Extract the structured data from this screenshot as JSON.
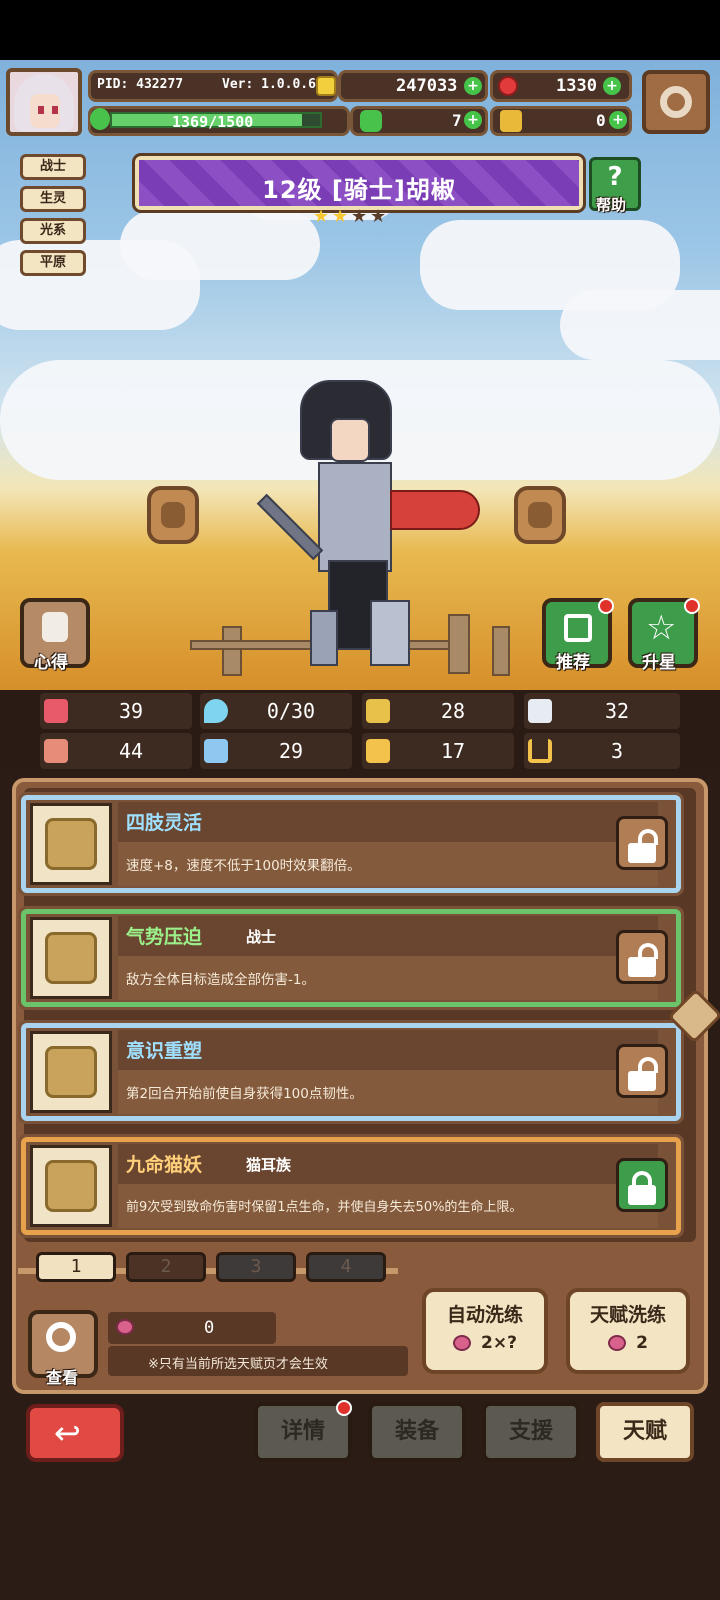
{
  "header": {
    "pid": "PID: 432277",
    "version": "Ver: 1.0.0.6",
    "gold": "247033",
    "gems": "1330",
    "xp": "1369/1500",
    "clover": "7",
    "keys": "0"
  },
  "tags": [
    "战士",
    "生灵",
    "光系",
    "平原"
  ],
  "title": "12级  [骑士]胡椒",
  "stars_filled": 2,
  "stars_total": 4,
  "help_label": "帮助",
  "side_buttons": {
    "notes": "心得",
    "recommend": "推荐",
    "upgrade_star": "升星"
  },
  "stats": [
    {
      "icon": "heart-icon",
      "value": "39",
      "color": "#e85a6a"
    },
    {
      "icon": "mana-drop-icon",
      "value": "0/30",
      "color": "#7fd4f0"
    },
    {
      "icon": "shield-icon",
      "value": "28",
      "color": "#e8c14a"
    },
    {
      "icon": "wing-icon",
      "value": "32",
      "color": "#e7ecf2"
    },
    {
      "icon": "fist-icon",
      "value": "44",
      "color": "#e88c7a"
    },
    {
      "icon": "book-icon",
      "value": "29",
      "color": "#8ec7ef"
    },
    {
      "icon": "boot-icon",
      "value": "17",
      "color": "#f2c24a"
    },
    {
      "icon": "horseshoe-icon",
      "value": "3",
      "color": "#f2c24a"
    }
  ],
  "talents": [
    {
      "name": "四肢灵活",
      "subtitle": "",
      "desc": "速度+8，速度不低于100时效果翻倍。",
      "frame": "#a8d4f0",
      "name_color": "#9fe0ff",
      "locked": false
    },
    {
      "name": "气势压迫",
      "subtitle": "战士",
      "desc": "敌方全体目标造成全部伤害-1。",
      "frame": "#6cc46a",
      "name_color": "#9cf08a",
      "locked": false
    },
    {
      "name": "意识重塑",
      "subtitle": "",
      "desc": "第2回合开始前使自身获得100点韧性。",
      "frame": "#a8d4f0",
      "name_color": "#9fe0ff",
      "locked": false
    },
    {
      "name": "九命猫妖",
      "subtitle": "猫耳族",
      "desc": "前9次受到致命伤害时保留1点生命，并使自身失去50%的生命上限。",
      "frame": "#e8a24c",
      "name_color": "#ffcf7a",
      "locked": true
    }
  ],
  "pages": [
    "1",
    "2",
    "3",
    "4"
  ],
  "view_label": "查看",
  "potion_count": "0",
  "notice": "※只有当前所选天赋页才会生效",
  "auto_refine": {
    "label": "自动洗练",
    "cost": "2×?"
  },
  "talent_refine": {
    "label": "天赋洗练",
    "cost": "2"
  },
  "nav": [
    "详情",
    "装备",
    "支援",
    "天赋"
  ]
}
